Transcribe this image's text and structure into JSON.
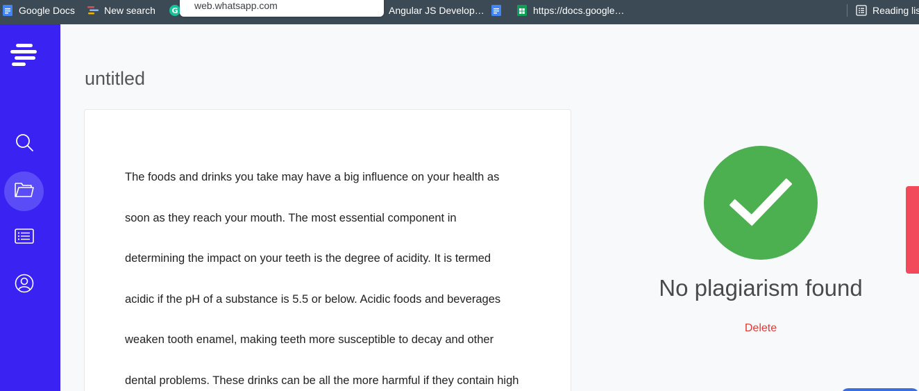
{
  "bookmarks": {
    "items": [
      {
        "label": "Google Docs",
        "icon": "google-docs-icon"
      },
      {
        "label": "New search",
        "icon": "new-search-icon"
      },
      {
        "label": "",
        "icon": "grammarly-icon"
      },
      {
        "label": "Angular JS Develop…",
        "icon": ""
      },
      {
        "label": "",
        "icon": "google-docs-icon"
      },
      {
        "label": "https://docs.google…",
        "icon": "google-sheets-icon"
      },
      {
        "label": "Reading lis",
        "icon": "reading-list-icon"
      }
    ],
    "tooltip": "web.whatsapp.com"
  },
  "sidebar": {
    "items": [
      {
        "name": "search",
        "icon": "search-icon"
      },
      {
        "name": "documents",
        "icon": "folder-icon",
        "active": true
      },
      {
        "name": "list",
        "icon": "list-icon"
      },
      {
        "name": "account",
        "icon": "user-icon"
      }
    ]
  },
  "document": {
    "title": "untitled",
    "lines": [
      "The foods and drinks you take may have a big influence on your health as",
      "soon as they reach your mouth. The most essential component in",
      "determining the impact on your teeth is the degree of acidity. It is termed",
      "acidic if the pH of a substance is 5.5 or below. Acidic foods and beverages",
      "weaken tooth enamel, making teeth more susceptible to decay and other",
      "dental problems. These drinks can be all the more harmful if they contain high"
    ]
  },
  "result": {
    "message": "No plagiarism found",
    "delete_label": "Delete",
    "icon": "checkmark-icon"
  },
  "colors": {
    "sidebar": "#3a22f2",
    "success": "#4caf50",
    "danger": "#e53935",
    "bookmarks_bar": "#3c4a55"
  }
}
